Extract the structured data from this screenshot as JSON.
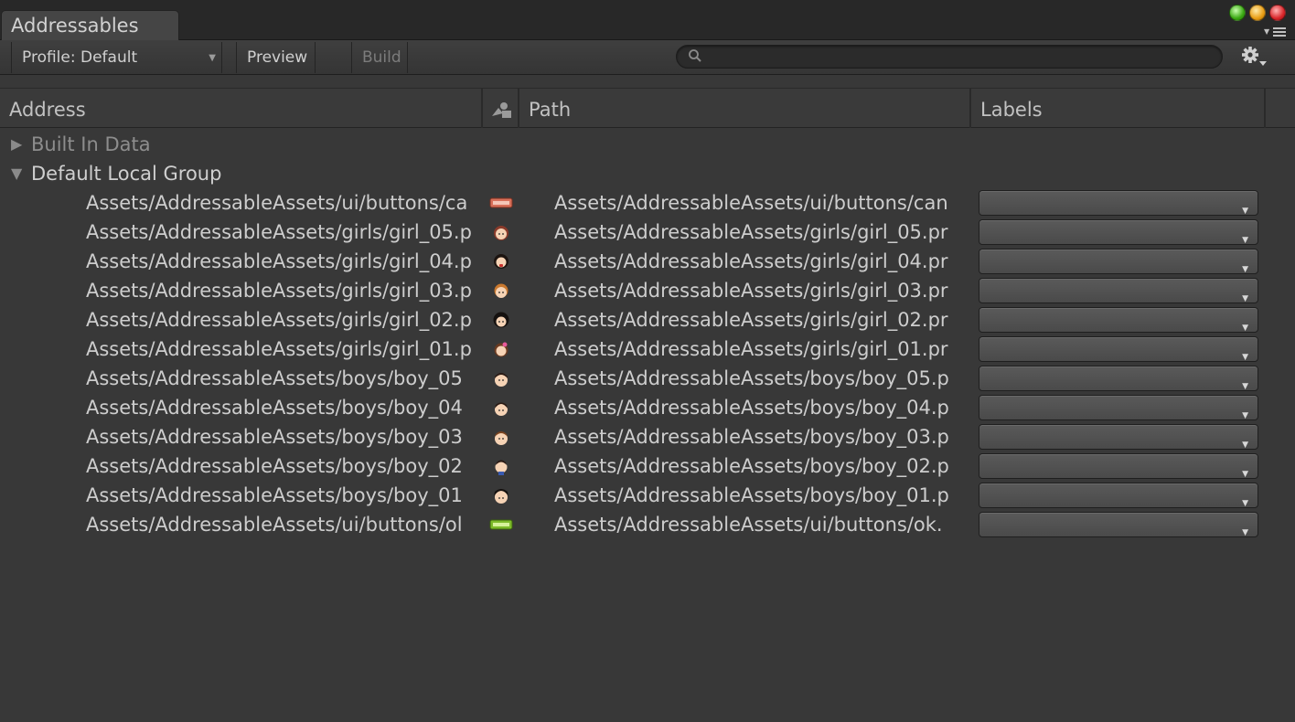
{
  "window": {
    "tab_title": "Addressables"
  },
  "toolbar": {
    "profile_label": "Profile: Default",
    "preview_label": "Preview",
    "build_label": "Build",
    "search_placeholder": ""
  },
  "header": {
    "address": "Address",
    "path": "Path",
    "labels": "Labels"
  },
  "groups": [
    {
      "name": "Built In Data",
      "expanded": false
    },
    {
      "name": "Default Local Group",
      "expanded": true
    }
  ],
  "entries": [
    {
      "address": "Assets/AddressableAssets/ui/buttons/ca",
      "path": "Assets/AddressableAssets/ui/buttons/can",
      "icon": "cancel-button-icon"
    },
    {
      "address": "Assets/AddressableAssets/girls/girl_05.p",
      "path": "Assets/AddressableAssets/girls/girl_05.pr",
      "icon": "girl-face-icon"
    },
    {
      "address": "Assets/AddressableAssets/girls/girl_04.p",
      "path": "Assets/AddressableAssets/girls/girl_04.pr",
      "icon": "girl-face-icon"
    },
    {
      "address": "Assets/AddressableAssets/girls/girl_03.p",
      "path": "Assets/AddressableAssets/girls/girl_03.pr",
      "icon": "girl-face-icon"
    },
    {
      "address": "Assets/AddressableAssets/girls/girl_02.p",
      "path": "Assets/AddressableAssets/girls/girl_02.pr",
      "icon": "girl-face-icon"
    },
    {
      "address": "Assets/AddressableAssets/girls/girl_01.p",
      "path": "Assets/AddressableAssets/girls/girl_01.pr",
      "icon": "girl-face-icon"
    },
    {
      "address": "Assets/AddressableAssets/boys/boy_05",
      "path": "Assets/AddressableAssets/boys/boy_05.p",
      "icon": "boy-face-icon"
    },
    {
      "address": "Assets/AddressableAssets/boys/boy_04",
      "path": "Assets/AddressableAssets/boys/boy_04.p",
      "icon": "boy-face-icon"
    },
    {
      "address": "Assets/AddressableAssets/boys/boy_03",
      "path": "Assets/AddressableAssets/boys/boy_03.p",
      "icon": "boy-face-icon"
    },
    {
      "address": "Assets/AddressableAssets/boys/boy_02",
      "path": "Assets/AddressableAssets/boys/boy_02.p",
      "icon": "boy-face-icon"
    },
    {
      "address": "Assets/AddressableAssets/boys/boy_01",
      "path": "Assets/AddressableAssets/boys/boy_01.p",
      "icon": "boy-face-icon"
    },
    {
      "address": "Assets/AddressableAssets/ui/buttons/ol",
      "path": "Assets/AddressableAssets/ui/buttons/ok.",
      "icon": "ok-button-icon"
    }
  ],
  "colors": {
    "background": "#383838",
    "tabbar": "#282828",
    "text": "#cdcdcd",
    "muted_text": "#8d8d8d",
    "girl_hair": "#8a3a2a",
    "boy_hair": "#2a1a14",
    "skin": "#f6d3b5",
    "cancel_button": "#d8705a",
    "ok_button": "#7dbb2a"
  }
}
